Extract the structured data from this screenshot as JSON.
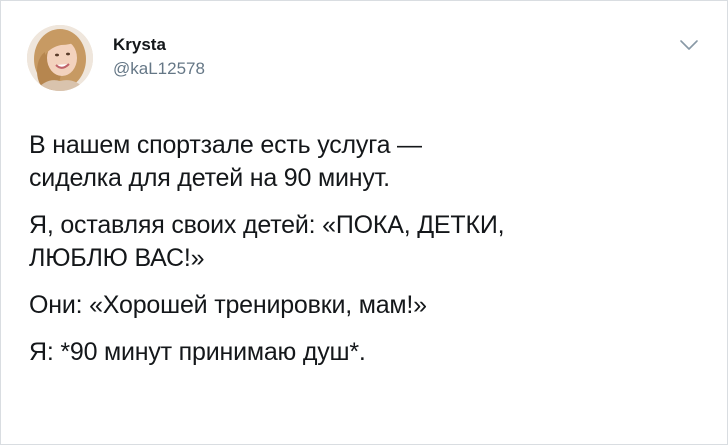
{
  "author": {
    "display_name": "Krysta",
    "handle": "@kaL12578",
    "avatar_icon": "user-avatar-photo"
  },
  "menu": {
    "icon": "chevron-down-icon"
  },
  "tweet": {
    "paragraphs": [
      {
        "lines": [
          "В нашем спортзале есть услуга —",
          "сиделка для детей на 90 минут."
        ]
      },
      {
        "lines": [
          "Я, оставляя своих детей: «ПОКА, ДЕТКИ,",
          "ЛЮБЛЮ ВАС!»"
        ]
      },
      {
        "lines": [
          "Они: «Хорошей тренировки, мам!»"
        ]
      },
      {
        "lines": [
          "Я: *90 минут принимаю душ*."
        ]
      }
    ]
  },
  "colors": {
    "text": "#14171a",
    "secondary": "#657786",
    "border": "#d9dde1",
    "chevron": "#8899a6"
  }
}
